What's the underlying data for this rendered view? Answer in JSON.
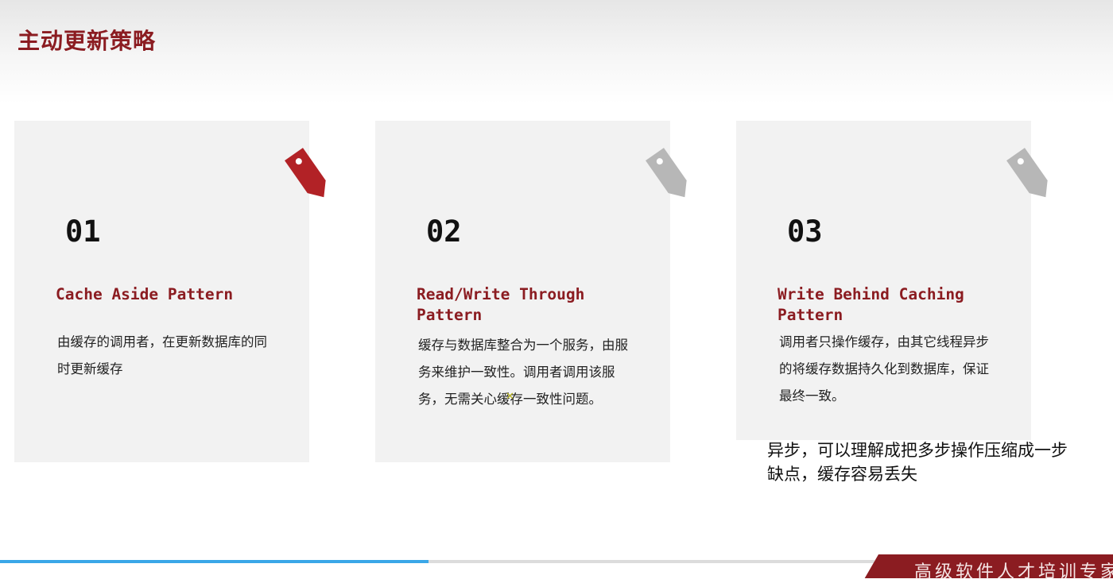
{
  "slide": {
    "title": "主动更新策略"
  },
  "cards": [
    {
      "number": "01",
      "title": "Cache Aside Pattern",
      "description": "由缓存的调用者，在更新数据库的同时更新缓存",
      "tag_color": "#b22226"
    },
    {
      "number": "02",
      "title": "Read/Write Through Pattern",
      "description": "缓存与数据库整合为一个服务，由服务来维护一致性。调用者调用该服务，无需关心缓存一致性问题。",
      "tag_color": "#b7b7b7"
    },
    {
      "number": "03",
      "title": "Write Behind Caching Pattern",
      "description": "调用者只操作缓存，由其它线程异步的将缓存数据持久化到数据库，保证最终一致。",
      "tag_color": "#b7b7b7"
    }
  ],
  "annotation": {
    "line1": "异步，可以理解成把多步操作压缩成一步",
    "line2": "缺点，缓存容易丢失"
  },
  "footer": {
    "banner_text": "高级软件人才培训专家"
  },
  "video": {
    "progress": 0.49
  },
  "colors": {
    "brand": "#8b1c21",
    "card_bg": "#f2f2f2",
    "progress": "#3aa7e8"
  }
}
